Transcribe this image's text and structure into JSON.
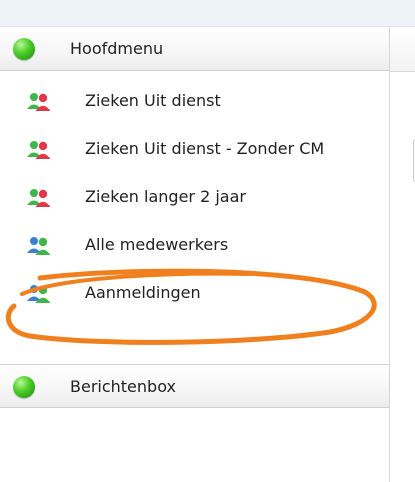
{
  "sidebar": {
    "main_section": {
      "title": "Hoofdmenu",
      "icon": "green-status-icon",
      "items": [
        {
          "label": "Zieken Uit dienst",
          "icon": "users-red-green-icon"
        },
        {
          "label": "Zieken Uit dienst - Zonder CM",
          "icon": "users-red-green-icon"
        },
        {
          "label": "Zieken langer 2 jaar",
          "icon": "users-red-green-icon"
        },
        {
          "label": "Alle medewerkers",
          "icon": "users-blue-green-icon"
        },
        {
          "label": "Aanmeldingen",
          "icon": "users-blue-green-icon"
        }
      ]
    },
    "message_section": {
      "title": "Berichtenbox",
      "icon": "green-status-icon"
    }
  },
  "annotation": {
    "color": "#f07f1e",
    "highlighted_item": "Aanmeldingen"
  },
  "colors": {
    "status_green": "#2fb516",
    "user_red": "#e0394a",
    "user_green": "#3fb54a",
    "user_blue": "#3b7fd0"
  }
}
